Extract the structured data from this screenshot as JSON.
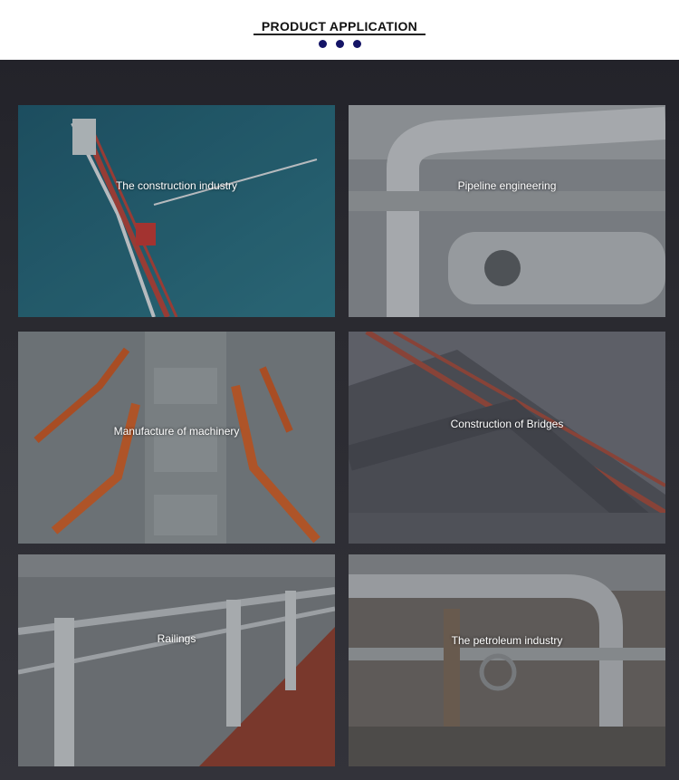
{
  "header": {
    "title": "PRODUCT APPLICATION"
  },
  "applications": [
    {
      "label": "The construction industry"
    },
    {
      "label": "Pipeline engineering"
    },
    {
      "label": "Manufacture of machinery"
    },
    {
      "label": "Construction of Bridges"
    },
    {
      "label": "Railings"
    },
    {
      "label": "The petroleum industry"
    }
  ],
  "colors": {
    "accent_dots": "#141466",
    "background_dark": "#2a2a30"
  }
}
